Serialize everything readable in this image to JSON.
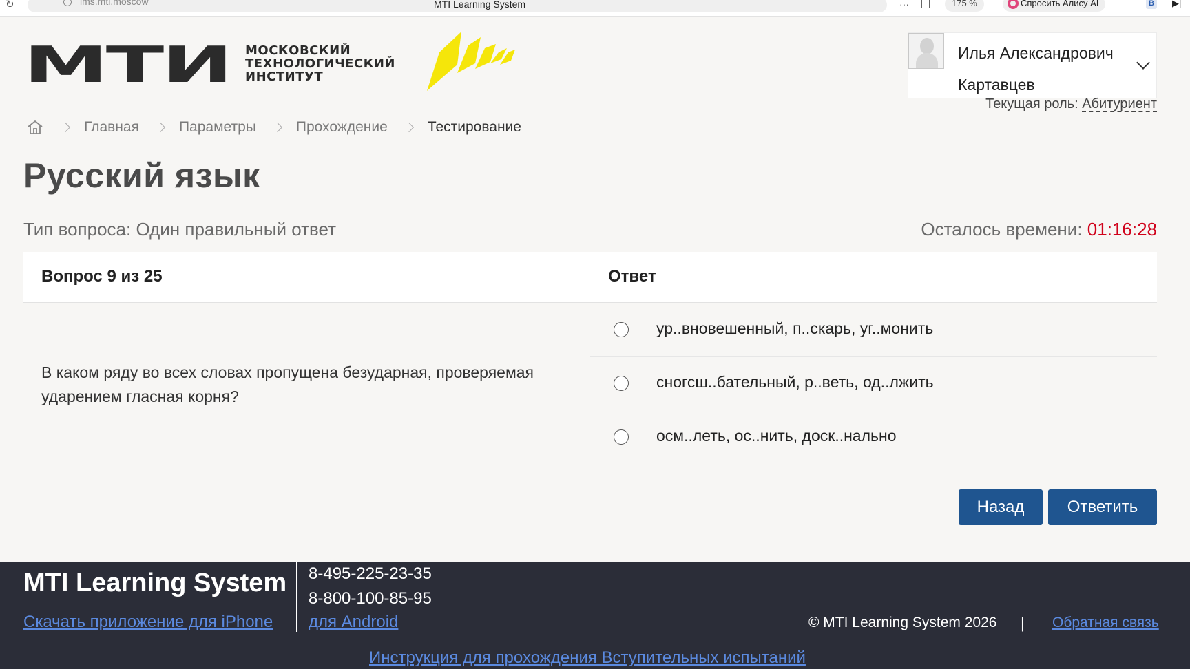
{
  "browser": {
    "url": "lms.mti.moscow",
    "tab_title": "MTI Learning System",
    "menu_dots": "···",
    "zoom": "175 %",
    "alice_label": "Спросить Алису AI",
    "ext_label": "B",
    "ext2_label": "▶|"
  },
  "logo": {
    "letters": "МТИ",
    "subtitle_lines": [
      "МОСКОВСКИЙ",
      "ТЕХНОЛОГИЧЕСКИЙ",
      "ИНСТИТУТ"
    ],
    "accent_color": "#f5e60a"
  },
  "user": {
    "name_first": "Илья Александрович",
    "name_last": "Картавцев",
    "role_label": "Текущая роль:",
    "role_value": "Абитуриент"
  },
  "breadcrumb": {
    "items": [
      "Главная",
      "Параметры",
      "Прохождение",
      "Тестирование"
    ]
  },
  "page": {
    "title": "Русский язык",
    "question_type": "Тип вопроса: Один правильный ответ",
    "time_label": "Осталось времени:",
    "time_value": "01:16:28"
  },
  "question": {
    "header_left": "Вопрос 9 из 25",
    "header_right": "Ответ",
    "text": "В каком ряду во всех словах пропущена безударная, проверяемая ударением гласная корня?",
    "answers": [
      "ур..вновешенный, п..скарь, уг..монить",
      "сногсш..бательный, р..веть, од..лжить",
      "осм..леть, ос..нить, доск..нально"
    ]
  },
  "actions": {
    "back": "Назад",
    "answer": "Ответить"
  },
  "footer": {
    "brand": "MTI Learning System",
    "phone1": "8-495-225-23-35",
    "phone2": "8-800-100-85-95",
    "iphone_link": "Скачать приложение для iPhone",
    "android_link": "для Android",
    "copyright": "© MTI Learning System 2026",
    "separator": "|",
    "feedback_link": "Обратная связь",
    "instructions_link": "Инструкция для прохождения Вступительных испытаний"
  },
  "colors": {
    "primary": "#1f5590",
    "timer": "#d0021b",
    "footer_bg": "#2b2d38",
    "link": "#5b8ae0"
  }
}
